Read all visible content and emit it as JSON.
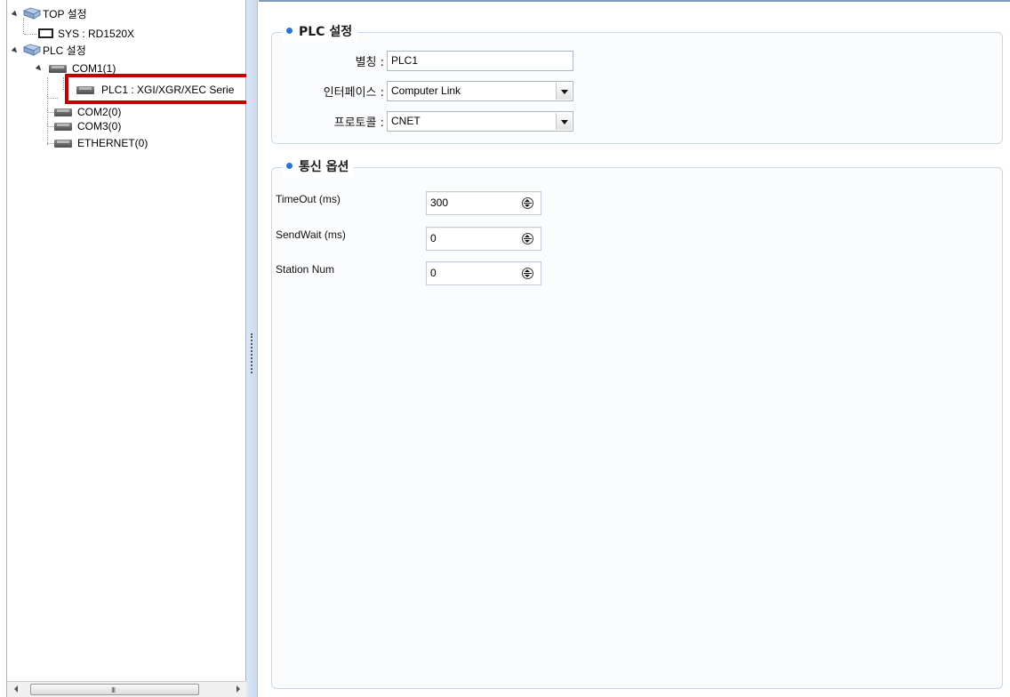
{
  "tree": {
    "top_settings": "TOP 설정",
    "sys": "SYS : RD1520X",
    "plc_settings": "PLC 설정",
    "com1": "COM1(1)",
    "plc1": "PLC1 : XGI/XGR/XEC Serie",
    "com2": "COM2(0)",
    "com3": "COM3(0)",
    "ethernet": "ETHERNET(0)"
  },
  "scrollbar": {
    "grip": "III"
  },
  "plc_section": {
    "title": "PLC 설정",
    "alias_label": "별칭 :",
    "alias_value": "PLC1",
    "interface_label": "인터페이스 :",
    "interface_value": "Computer Link",
    "protocol_label": "프로토콜 :",
    "protocol_value": "CNET"
  },
  "comm_section": {
    "title": "통신 옵션",
    "timeout_label": "TimeOut (ms)",
    "timeout_value": "300",
    "sendwait_label": "SendWait (ms)",
    "sendwait_value": "0",
    "station_label": "Station Num",
    "station_value": "0"
  },
  "colors": {
    "accent": "#2a74c9",
    "highlight_border": "#c00000",
    "splitter": "#c9d9ee"
  }
}
